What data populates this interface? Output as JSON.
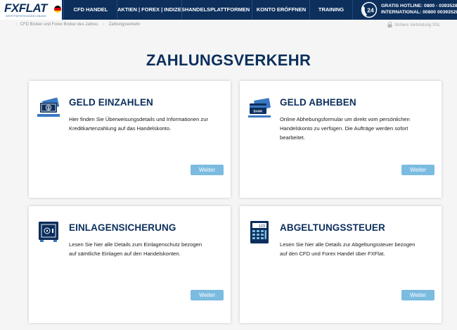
{
  "header": {
    "logo_text": "FXFLAT",
    "logo_sub": "WERTPAPIERHANDELSBANK",
    "nav": [
      {
        "label": "CFD HANDEL"
      },
      {
        "label": "AKTIEN | FOREX | INDIZES"
      },
      {
        "label": "HANDELSPLATTFORMEN"
      },
      {
        "label": "KONTO ERÖFFNEN"
      },
      {
        "label": "TRAINING"
      }
    ],
    "hotline_badge": "24",
    "hotline_line1": "GRATIS HOTLINE: 0800 - 0393528",
    "hotline_line2": "INTERNATIONAL: 00800 00393528",
    "colors": {
      "nav_bg": "#0c2f5c",
      "accent": "#7bbbe0"
    }
  },
  "breadcrumb": {
    "items": [
      "CFD Broker und Forex Broker des Jahres",
      "Zahlungsverkehr"
    ],
    "separator": "›"
  },
  "secure_label": "Sichere Verbindung SSL",
  "page_title": "ZAHLUNGSVERKEHR",
  "cards": [
    {
      "title": "GELD EINZAHLEN",
      "text": "Hier finden Sie Überweisungsdetails und Informationen zur Kreditkartenzahlung auf das Handelskonto.",
      "button": "Weiter",
      "icon": "banknotes-icon"
    },
    {
      "title": "GELD ABHEBEN",
      "text": "Online Abhebungsformular um direkt vom persönlichen Handelskonto zu verfügen. Die Aufträge werden sofort bearbeitet.",
      "button": "Weiter",
      "icon": "bank-cards-icon",
      "icon_label": "BANK"
    },
    {
      "title": "EINLAGENSICHERUNG",
      "text": "Lesen Sie hier alle Details zum Einlagenschutz bezogen auf sämtliche Einlagen auf den Handelskonten.",
      "button": "Weiter",
      "icon": "safe-icon"
    },
    {
      "title": "ABGELTUNGSSTEUER",
      "text": "Lesen Sie hier alle Details zur Abgeltungssteuer bezogen auf den CFD und Forex Handel über FXFlat.",
      "button": "Weiter",
      "icon": "calculator-icon",
      "icon_label": "123"
    }
  ]
}
